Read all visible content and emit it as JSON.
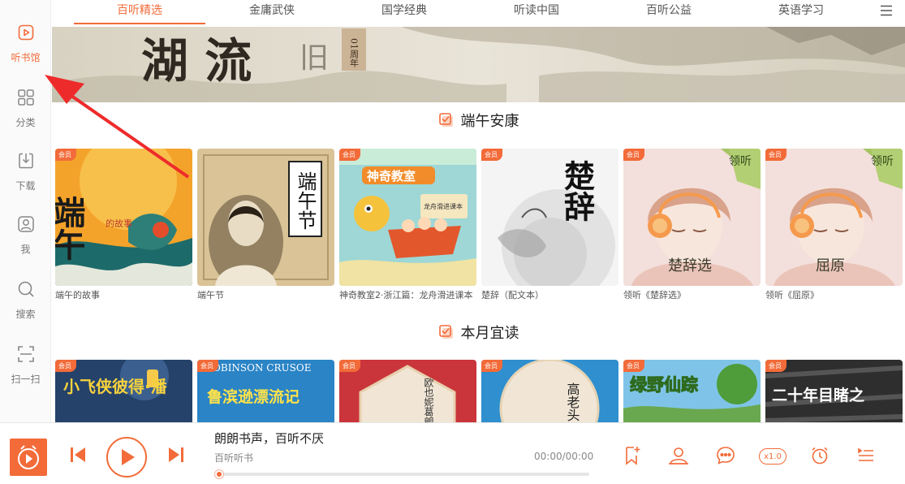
{
  "colors": {
    "accent": "#f26b39"
  },
  "sidebar": {
    "items": [
      {
        "label": "听书馆",
        "icon": "play-square-icon",
        "active": true
      },
      {
        "label": "分类",
        "icon": "grid-icon",
        "active": false
      },
      {
        "label": "下载",
        "icon": "download-icon",
        "active": false
      },
      {
        "label": "我",
        "icon": "user-icon",
        "active": false
      },
      {
        "label": "搜索",
        "icon": "search-icon",
        "active": false
      },
      {
        "label": "扫一扫",
        "icon": "scan-icon",
        "active": false
      }
    ]
  },
  "tabs": [
    {
      "label": "百听精选",
      "active": true
    },
    {
      "label": "金庸武侠",
      "active": false
    },
    {
      "label": "国学经典",
      "active": false
    },
    {
      "label": "听读中国",
      "active": false
    },
    {
      "label": "百听公益",
      "active": false
    },
    {
      "label": "英语学习",
      "active": false
    }
  ],
  "banner": {
    "text_main": "湖 流",
    "text_side": "旧",
    "text_vertical": "01周年"
  },
  "sections": [
    {
      "title": "端午安康",
      "books": [
        {
          "badge": "会员",
          "title": "端午的故事",
          "cover_text": "端午",
          "cover_subtext": "的故事"
        },
        {
          "badge": "",
          "title": "端午节",
          "cover_text": "端午节"
        },
        {
          "badge": "会员",
          "title": "神奇教室2·浙江篇：龙舟滑进课本",
          "cover_text": "神奇教室",
          "cover_subtext": "龙舟滑进课本"
        },
        {
          "badge": "会员",
          "title": "楚辞（配文本）",
          "cover_text": "楚辞"
        },
        {
          "badge": "会员",
          "title": "领听《楚辞选》",
          "cover_text": "楚辞选",
          "cover_corner": "领听"
        },
        {
          "badge": "会员",
          "title": "领听《屈原》",
          "cover_text": "屈原",
          "cover_corner": "领听"
        }
      ]
    },
    {
      "title": "本月宜读",
      "books": [
        {
          "badge": "会员",
          "title": "",
          "cover_text": "小飞侠彼得·潘"
        },
        {
          "badge": "会员",
          "title": "",
          "cover_text": "鲁滨逊漂流记",
          "cover_subtext": "ROBINSON CRUSOE"
        },
        {
          "badge": "会员",
          "title": "",
          "cover_text": "欧也妮葛朗台"
        },
        {
          "badge": "会员",
          "title": "",
          "cover_text": "高老头"
        },
        {
          "badge": "会员",
          "title": "",
          "cover_text": "绿野仙踪"
        },
        {
          "badge": "会员",
          "title": "",
          "cover_text": "二十年目睹之"
        }
      ]
    }
  ],
  "player": {
    "title": "朗朗书声，百听不厌",
    "source": "百听听书",
    "time": "00:00/00:00",
    "progress": 0,
    "speed": "x1.0"
  }
}
